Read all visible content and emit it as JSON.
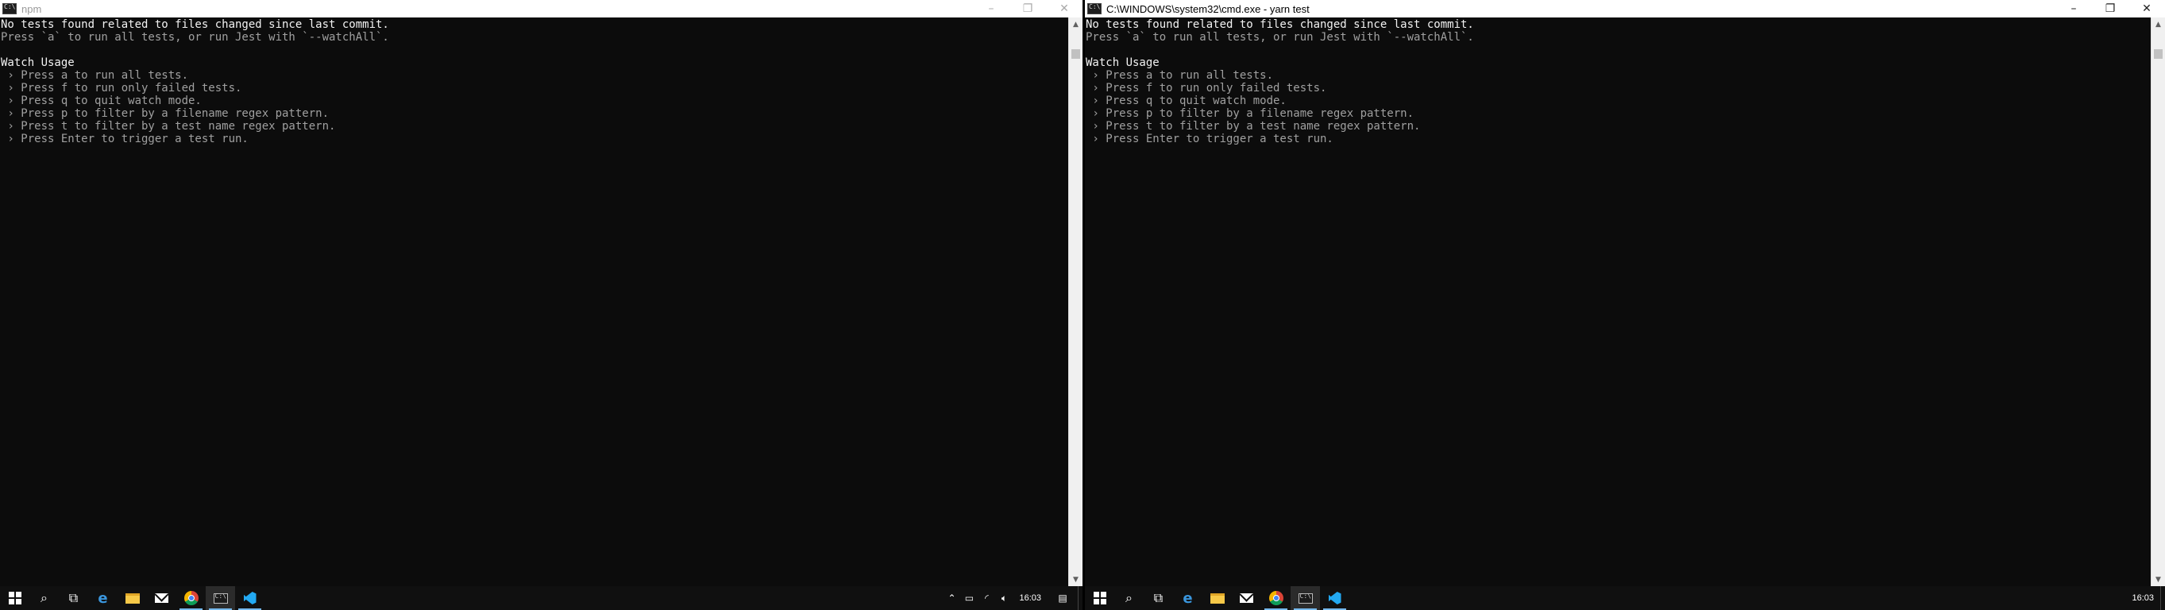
{
  "left": {
    "window": {
      "title": "npm"
    },
    "console": {
      "lines": [
        "No tests found related to files changed since last commit.",
        "Press `a` to run all tests, or run Jest with `--watchAll`.",
        "",
        "Watch Usage",
        " › Press a to run all tests.",
        " › Press f to run only failed tests.",
        " › Press q to quit watch mode.",
        " › Press p to filter by a filename regex pattern.",
        " › Press t to filter by a test name regex pattern.",
        " › Press Enter to trigger a test run."
      ]
    },
    "taskbar": {
      "clock": "16:03"
    }
  },
  "right": {
    "window": {
      "title": "C:\\WINDOWS\\system32\\cmd.exe - yarn  test"
    },
    "console": {
      "lines": [
        "No tests found related to files changed since last commit.",
        "Press `a` to run all tests, or run Jest with `--watchAll`.",
        "",
        "Watch Usage",
        " › Press a to run all tests.",
        " › Press f to run only failed tests.",
        " › Press q to quit watch mode.",
        " › Press p to filter by a filename regex pattern.",
        " › Press t to filter by a test name regex pattern.",
        " › Press Enter to trigger a test run."
      ]
    },
    "taskbar": {
      "clock": "16:03"
    }
  },
  "taskbar_icons": [
    "windows-start-icon",
    "search-icon",
    "task-view-icon",
    "edge-icon",
    "file-explorer-icon",
    "mail-icon",
    "chrome-icon",
    "cmd-icon",
    "vscode-icon"
  ],
  "window_controls": {
    "minimize": "–",
    "maximize": "❐",
    "close": "✕"
  },
  "tray_icons": [
    "chevron-up-icon",
    "battery-icon",
    "wifi-icon",
    "volume-icon"
  ],
  "colors": {
    "console_bg": "#0c0c0c",
    "console_fg": "#cccccc",
    "taskbar_bg": "#101010",
    "accent": "#76b9ed"
  }
}
